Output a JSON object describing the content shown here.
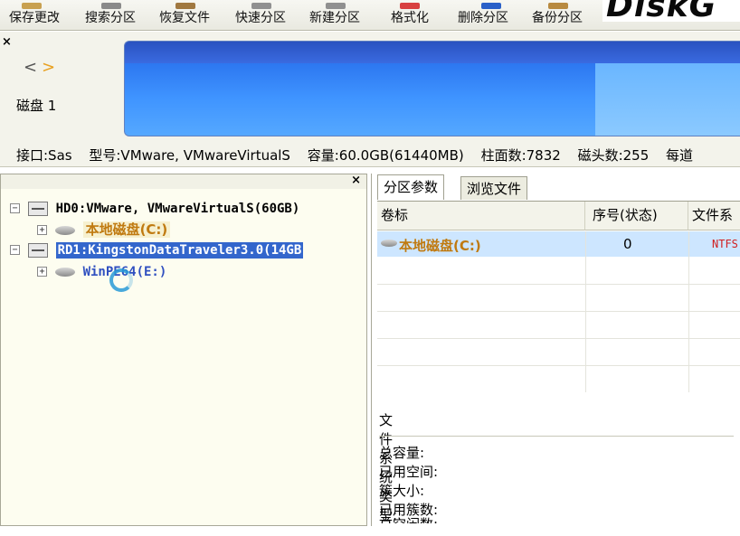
{
  "toolbar": {
    "save": "保存更改",
    "search": "搜索分区",
    "recover": "恢复文件",
    "quick_partition": "快速分区",
    "new_partition": "新建分区",
    "format": "格式化",
    "delete_partition": "删除分区",
    "backup_partition": "备份分区",
    "brand": "DiskG"
  },
  "disk_panel": {
    "close": "×",
    "disk_label": "磁盘 1",
    "interface": "接口:Sas",
    "model": "型号:VMware, VMwareVirtualS",
    "capacity": "容量:60.0GB(61440MB)",
    "cylinders": "柱面数:7832",
    "heads": "磁头数:255",
    "sectors_per_track": "每道"
  },
  "tree": {
    "close": "×",
    "hd0": "HD0:VMware, VMwareVirtualS(60GB)",
    "c_volume": "本地磁盘(C:)",
    "rd1": "RD1:KingstonDataTraveler3.0(14GB",
    "e_volume": "WinPE64(E:)"
  },
  "tabs": {
    "params": "分区参数",
    "browse": "浏览文件"
  },
  "grid": {
    "headers": [
      "卷标",
      "序号(状态)",
      "文件系"
    ],
    "rows": [
      {
        "label": "本地磁盘(C:)",
        "seq": "0",
        "fs": "NTFS"
      }
    ]
  },
  "details": {
    "fs_type": "文件系统类型:",
    "total": "总容量:",
    "used": "已用空间:",
    "cluster_size": "簇大小:",
    "used_clusters": "已用簇数:",
    "free_clusters": "总空闲数:"
  },
  "colors": {
    "selection": "#3366cc",
    "volume_label": "#c07a10",
    "filesystem": "#d02020"
  }
}
